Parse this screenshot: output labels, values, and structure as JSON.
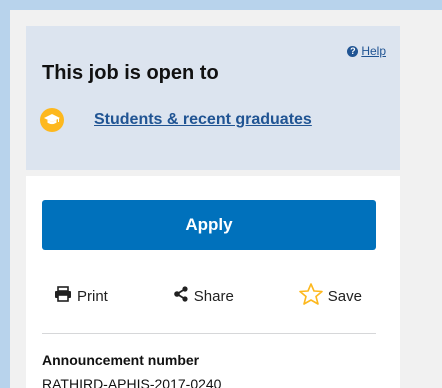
{
  "help": {
    "label": "Help",
    "icon": "question-circle-icon"
  },
  "open_to": {
    "title": "This job is open to",
    "hiring_path": "Students & recent graduates",
    "hiring_icon": "graduation-cap-icon"
  },
  "actions": {
    "apply_label": "Apply",
    "print_label": "Print",
    "share_label": "Share",
    "save_label": "Save"
  },
  "announcement": {
    "label": "Announcement number",
    "value": "RATHIRD-APHIS-2017-0240"
  },
  "colors": {
    "page_border": "#b8d3ec",
    "panel_bg": "#dce4ef",
    "link": "#205493",
    "apply_bg": "#0071bc",
    "badge": "#fdb81e",
    "star_outline": "#fdb81e"
  }
}
